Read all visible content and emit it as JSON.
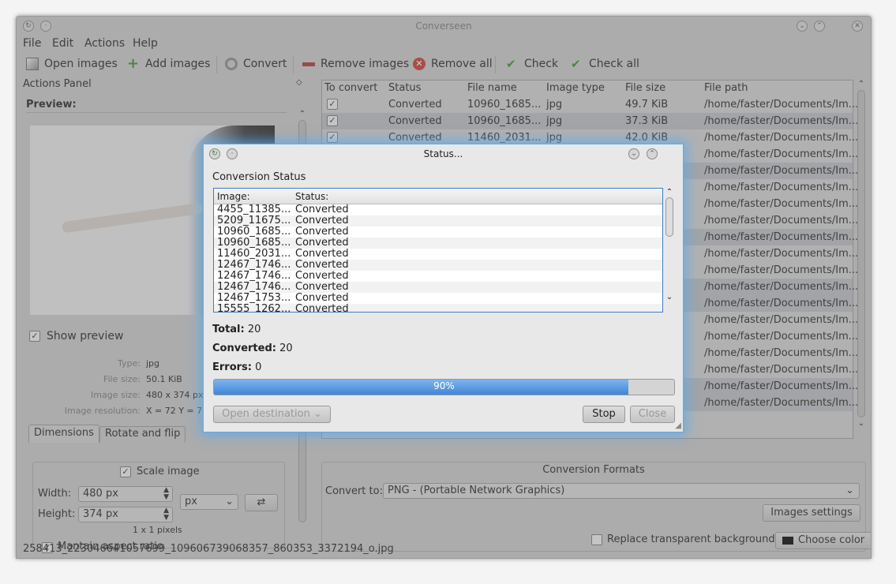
{
  "window": {
    "title": "Converseen"
  },
  "menu": [
    "File",
    "Edit",
    "Actions",
    "Help"
  ],
  "toolbar": {
    "open_images": "Open images",
    "add_images": "Add images",
    "convert": "Convert",
    "remove_images": "Remove images",
    "remove_all": "Remove all",
    "check": "Check",
    "check_all": "Check all"
  },
  "actions_panel": {
    "title": "Actions Panel",
    "preview_label": "Preview:",
    "show_preview": "Show preview",
    "info": [
      {
        "label": "Type:",
        "value": "jpg"
      },
      {
        "label": "File size:",
        "value": "50.1 KiB"
      },
      {
        "label": "Image size:",
        "value": "480 x 374 px"
      },
      {
        "label": "Image resolution:",
        "value": "X = 72 Y = 72"
      }
    ],
    "tabs": [
      "Dimensions",
      "Rotate and flip"
    ],
    "scale_image": "Scale image",
    "width_label": "Width:",
    "width_value": "480 px",
    "height_label": "Height:",
    "height_value": "374 px",
    "unit": "px",
    "ratio": "1 x 1 pixels",
    "maintain_aspect": "Mantain aspect ratio"
  },
  "table": {
    "headers": [
      "To convert",
      "Status",
      "File name",
      "Image type",
      "File size",
      "File path"
    ],
    "rows": [
      {
        "status": "Converted",
        "name": "10960_1685...",
        "type": "jpg",
        "size": "49.7 KiB",
        "path": "/home/faster/Documents/Im..."
      },
      {
        "status": "Converted",
        "name": "10960_1685...",
        "type": "jpg",
        "size": "37.3 KiB",
        "path": "/home/faster/Documents/Im..."
      },
      {
        "status": "Converted",
        "name": "11460_2031...",
        "type": "jpg",
        "size": "42.0 KiB",
        "path": "/home/faster/Documents/Im..."
      }
    ],
    "path_rows": [
      "/home/faster/Documents/Im...",
      "/home/faster/Documents/Im...",
      "/home/faster/Documents/Im...",
      "/home/faster/Documents/Im...",
      "/home/faster/Documents/Im...",
      "/home/faster/Documents/Im...",
      "/home/faster/Documents/Im...",
      "/home/faster/Documents/Im...",
      "/home/faster/Documents/Im...",
      "/home/faster/Documents/Im...",
      "/home/faster/Documents/Im...",
      "/home/faster/Documents/Im...",
      "/home/faster/Documents/Im...",
      "/home/faster/Documents/Im...",
      "/home/faster/Documents/Im...",
      "/home/faster/Documents/Im..."
    ]
  },
  "conversion_formats": {
    "title": "Conversion Formats",
    "convert_to_label": "Convert to:",
    "format": "PNG - (Portable Network Graphics)",
    "images_settings": "Images settings",
    "replace_bg": "Replace transparent background",
    "choose_color": "Choose color"
  },
  "status_bar": "258413_223046641057699_109606739068357_860353_3372194_o.jpg",
  "dialog": {
    "title": "Status...",
    "heading": "Conversion Status",
    "col_image": "Image:",
    "col_status": "Status:",
    "items": [
      {
        "image": "4455_11385...",
        "status": "Converted"
      },
      {
        "image": "5209_11675...",
        "status": "Converted"
      },
      {
        "image": "10960_1685...",
        "status": "Converted"
      },
      {
        "image": "10960_1685...",
        "status": "Converted"
      },
      {
        "image": "11460_2031...",
        "status": "Converted"
      },
      {
        "image": "12467_1746...",
        "status": "Converted"
      },
      {
        "image": "12467_1746...",
        "status": "Converted"
      },
      {
        "image": "12467_1746...",
        "status": "Converted"
      },
      {
        "image": "12467_1753...",
        "status": "Converted"
      },
      {
        "image": "15555_1262...",
        "status": "Converted"
      }
    ],
    "total_label": "Total:",
    "total": "20",
    "converted_label": "Converted:",
    "converted": "20",
    "errors_label": "Errors:",
    "errors": "0",
    "progress": 90,
    "progress_text": "90%",
    "open_destination": "Open destination",
    "stop": "Stop",
    "close": "Close"
  }
}
